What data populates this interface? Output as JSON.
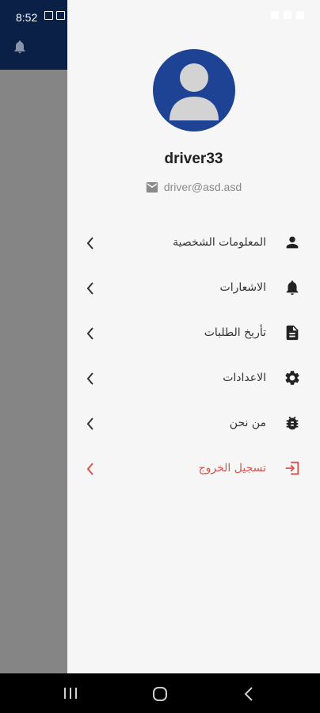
{
  "status_bar": {
    "time": "8:52"
  },
  "profile": {
    "username": "driver33",
    "email": "driver@asd.asd"
  },
  "menu": [
    {
      "label": "المعلومات الشخصية",
      "icon": "person-icon"
    },
    {
      "label": "الاشعارات",
      "icon": "bell-icon"
    },
    {
      "label": "تأريخ الطلبات",
      "icon": "document-icon"
    },
    {
      "label": "الاعدادات",
      "icon": "gear-icon"
    },
    {
      "label": "من نحن",
      "icon": "bug-icon"
    },
    {
      "label": "تسجيل الخروج",
      "icon": "logout-icon"
    }
  ],
  "colors": {
    "header": "#0b2046",
    "avatar": "#1e4394",
    "logout": "#d9534f",
    "drawer_bg": "#f6f6f6"
  }
}
